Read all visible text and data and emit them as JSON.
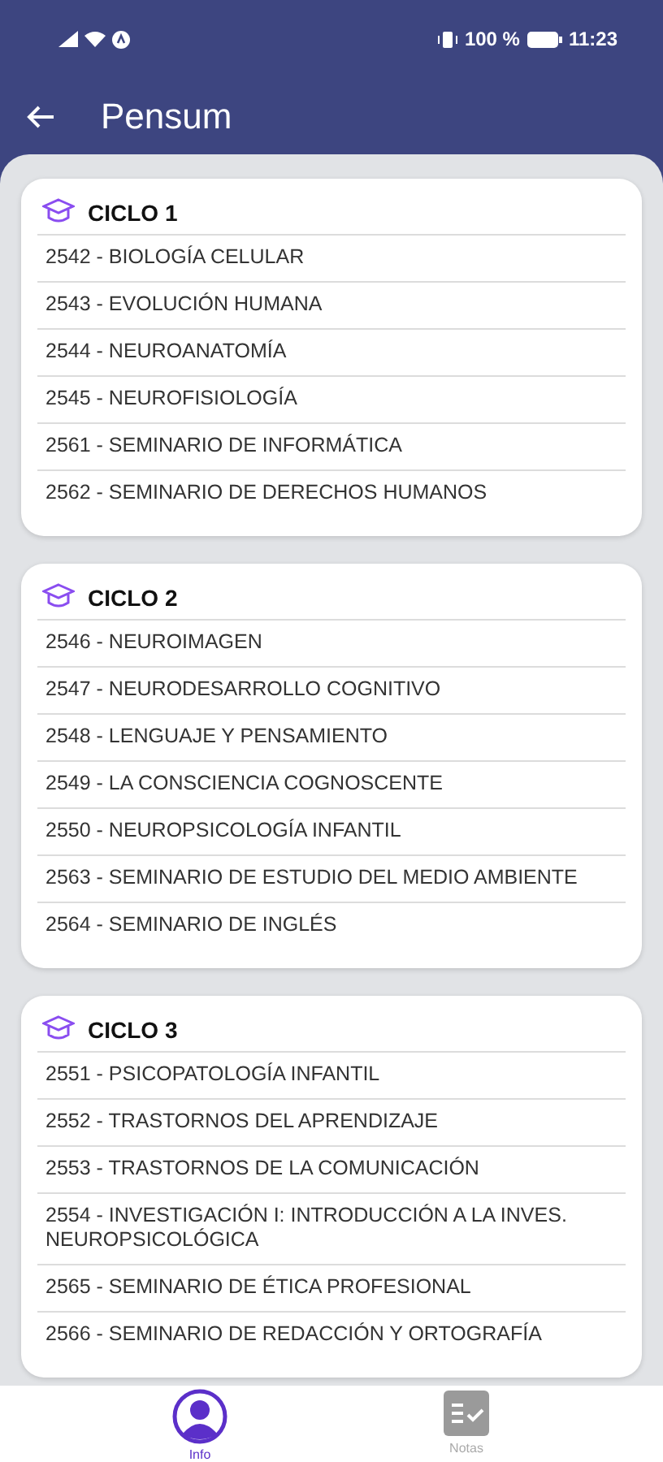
{
  "status_bar": {
    "battery": "100 %",
    "time": "11:23"
  },
  "app_bar": {
    "title": "Pensum"
  },
  "cycles": [
    {
      "title": "CICLO 1",
      "courses": [
        "2542 - BIOLOGÍA CELULAR",
        "2543 - EVOLUCIÓN HUMANA",
        "2544 - NEUROANATOMÍA",
        "2545 - NEUROFISIOLOGÍA",
        "2561 - SEMINARIO DE INFORMÁTICA",
        "2562 - SEMINARIO DE DERECHOS HUMANOS"
      ]
    },
    {
      "title": "CICLO 2",
      "courses": [
        "2546 - NEUROIMAGEN",
        "2547 - NEURODESARROLLO COGNITIVO",
        "2548 - LENGUAJE Y PENSAMIENTO",
        "2549 - LA CONSCIENCIA COGNOSCENTE",
        "2550 - NEUROPSICOLOGÍA INFANTIL",
        "2563 - SEMINARIO DE ESTUDIO DEL MEDIO AMBIENTE",
        "2564 - SEMINARIO DE INGLÉS"
      ]
    },
    {
      "title": "CICLO 3",
      "courses": [
        "2551 - PSICOPATOLOGÍA INFANTIL",
        "2552 - TRASTORNOS DEL APRENDIZAJE",
        "2553 - TRASTORNOS DE LA COMUNICACIÓN",
        "2554 - INVESTIGACIÓN I: INTRODUCCIÓN A LA INVES. NEUROPSICOLÓGICA",
        "2565 - SEMINARIO DE ÉTICA PROFESIONAL",
        "2566 - SEMINARIO DE REDACCIÓN Y ORTOGRAFÍA"
      ]
    }
  ],
  "bottom_nav": [
    {
      "kind": "profile",
      "label": "Info",
      "selected": true
    },
    {
      "kind": "grades",
      "label": "Notas",
      "selected": false
    }
  ]
}
